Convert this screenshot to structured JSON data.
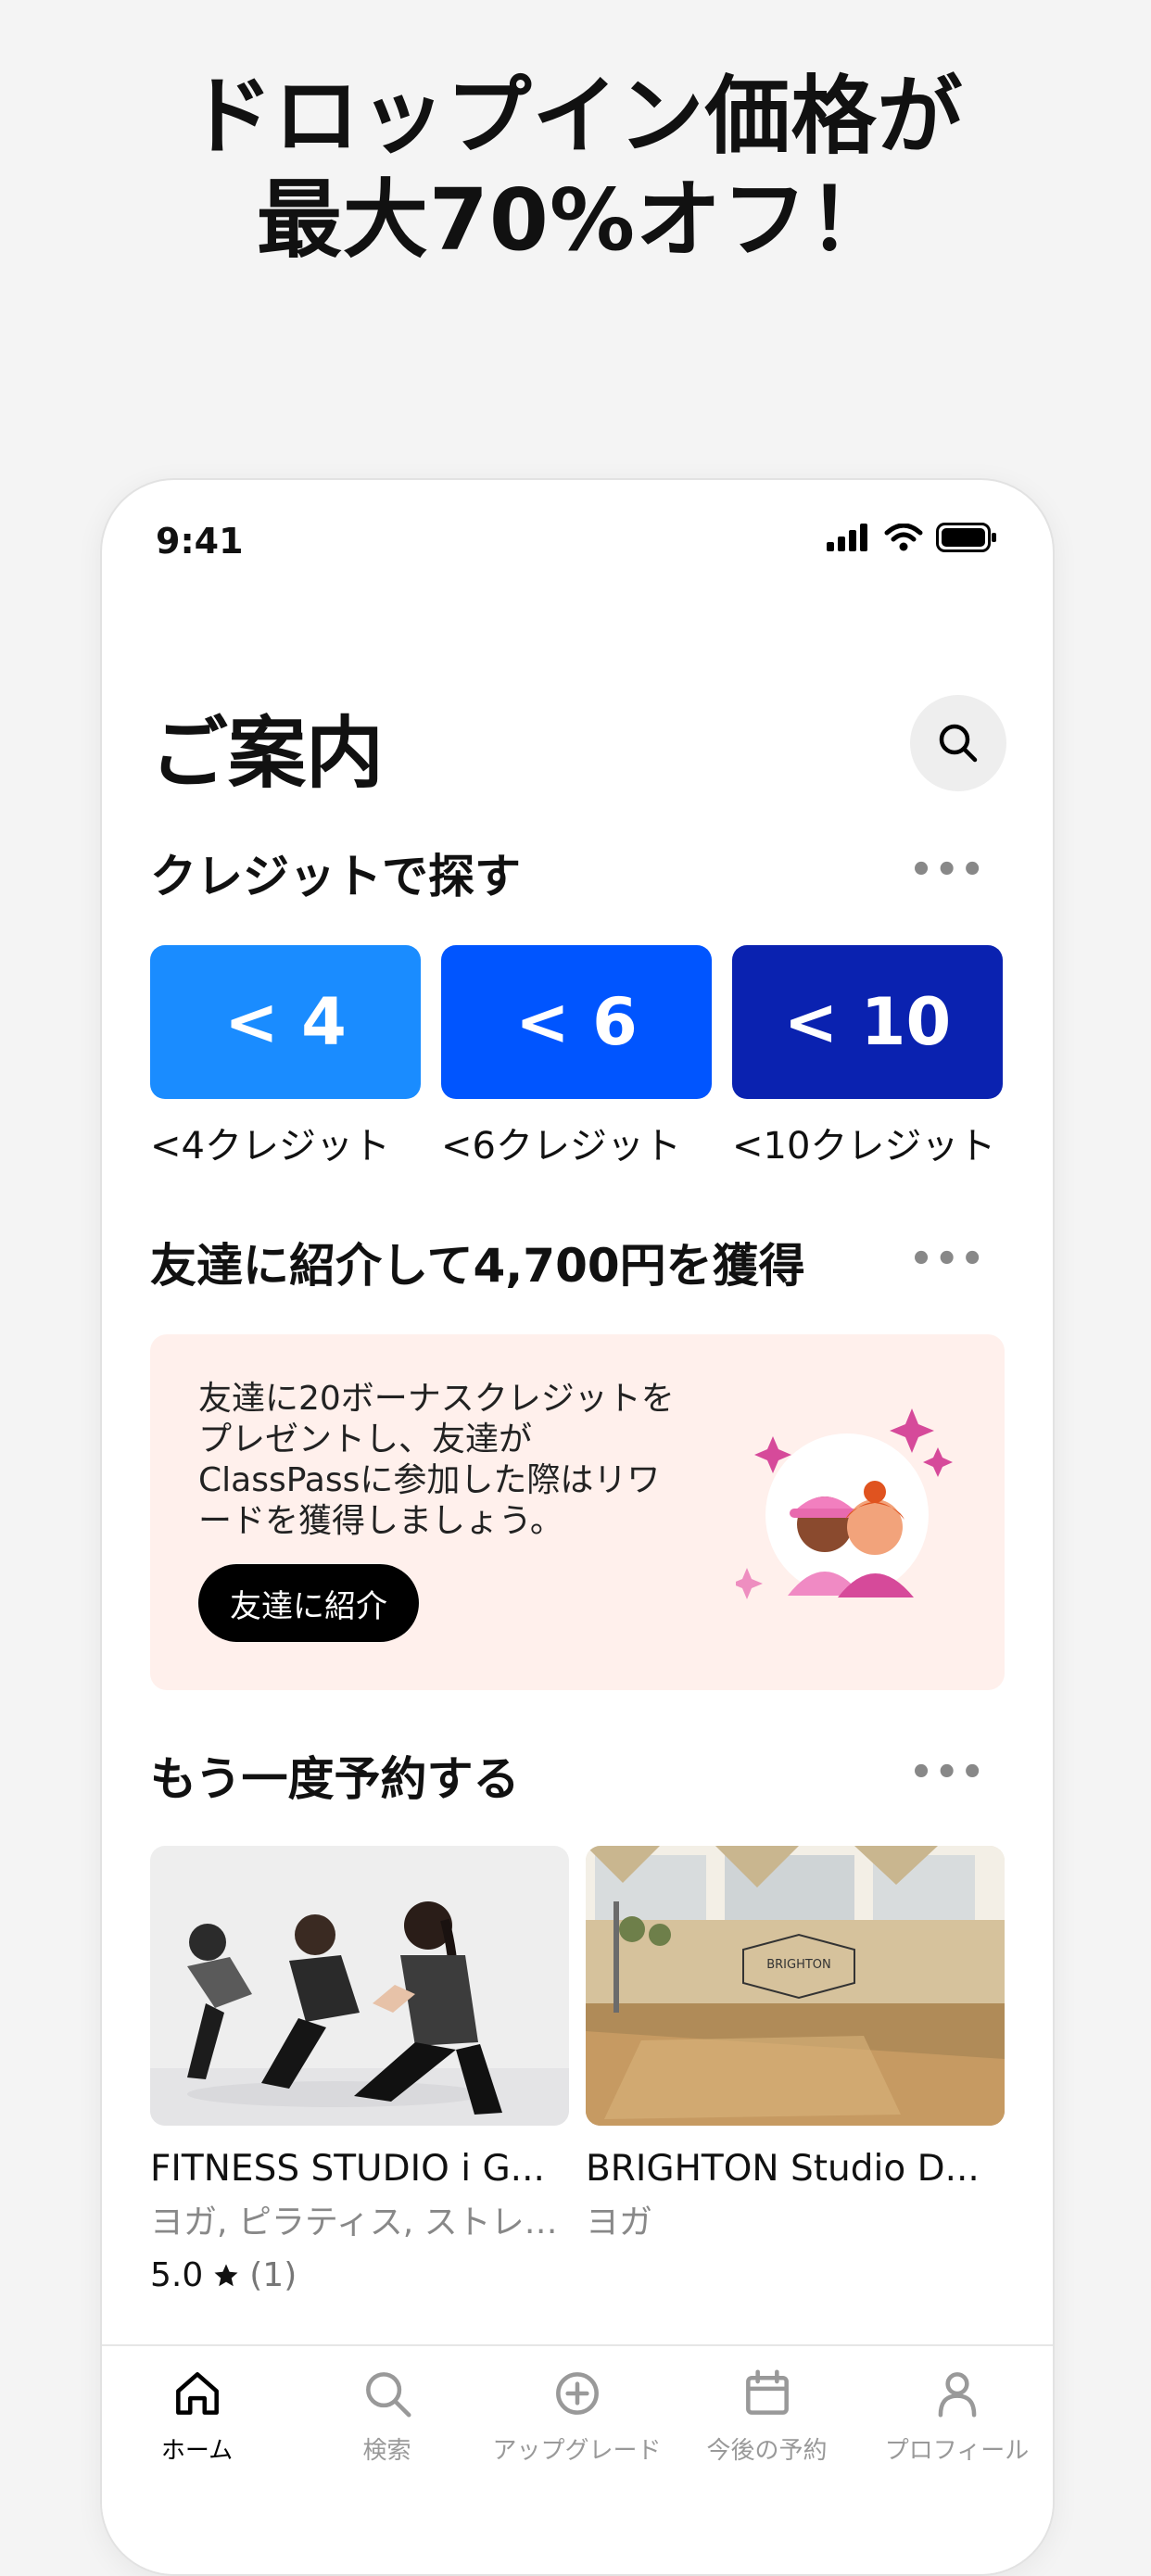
{
  "headline": {
    "line1": "ドロップイン価格が",
    "line2": "最大70%オフ！"
  },
  "status_bar": {
    "time": "9:41"
  },
  "page": {
    "title": "ご案内"
  },
  "credits_section": {
    "title": "クレジットで探す",
    "more": "•••",
    "tiles": [
      {
        "value": "< 4",
        "label": "<4クレジット",
        "color": "#1a8cff"
      },
      {
        "value": "< 6",
        "label": "<6クレジット",
        "color": "#0055ff"
      },
      {
        "value": "< 10",
        "label": "<10クレジット",
        "color": "#0a22b0"
      }
    ]
  },
  "referral_section": {
    "title": "友達に紹介して4,700円を獲得",
    "more": "•••",
    "body": "友達に20ボーナスクレジットをプレゼントし、友達がClassPassに参加した際はリワードを獲得しましょう。",
    "button": "友達に紹介",
    "card_color": "#fff0ec"
  },
  "rebook_section": {
    "title": "もう一度予約する",
    "more": "•••",
    "studios": [
      {
        "name": "FITNESS STUDIO i G...",
        "category": "ヨガ, ピラティス, ストレ…",
        "rating": "5.0",
        "count": "(1)"
      },
      {
        "name": "BRIGHTON Studio D...",
        "category": "ヨガ"
      }
    ]
  },
  "tab_bar": {
    "tabs": [
      {
        "label": "ホーム",
        "icon": "home-icon",
        "active": true
      },
      {
        "label": "検索",
        "icon": "search-icon"
      },
      {
        "label": "アップグレード",
        "icon": "plus-circle-icon"
      },
      {
        "label": "今後の予約",
        "icon": "calendar-icon"
      },
      {
        "label": "プロフィール",
        "icon": "person-icon"
      }
    ]
  }
}
